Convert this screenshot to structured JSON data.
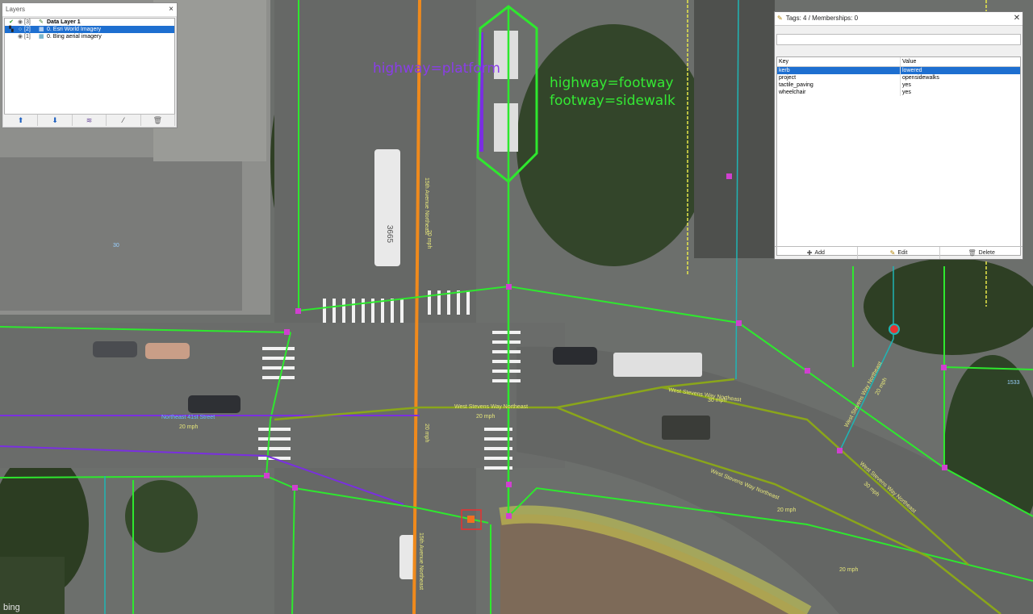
{
  "map": {
    "annotations": {
      "platform": "highway=platform",
      "footway_line1": "highway=footway",
      "footway_line2": "footway=sidewalk"
    },
    "street_labels": {
      "ave_north": "15th Avenue Northeast",
      "ave_south": "15th Avenue Northeast",
      "stevens_west": "West Stevens Way Northeast",
      "stevens_curve": "West Stevens Way Northeast",
      "stevens_curve2": "West Stevens Way Northeast",
      "stevens_north": "West Stevens Way Northeast",
      "stevens_ne_right": "West Stevens Way Northeast",
      "ne41": "Northeast 41st Street"
    },
    "speed_labels": [
      "20 mph",
      "20 mph",
      "20 mph",
      "30 mph",
      "20 mph",
      "30 mph",
      "20 mph",
      "20 mph",
      "20 mph"
    ],
    "bus_number": "3665",
    "node_label": "1533",
    "node_label2": "30"
  },
  "imagery_credit": "bing",
  "layers": {
    "title": "Layers",
    "close": "×",
    "items": [
      {
        "index": "[3]",
        "name": "Data Layer 1",
        "bold": true,
        "selected": false
      },
      {
        "index": "[2]",
        "name": "0. Esri World Imagery",
        "bold": false,
        "selected": true
      },
      {
        "index": "[1]",
        "name": "0. Bing aerial imagery",
        "bold": false,
        "selected": false
      }
    ],
    "toolbar": [
      "move-up-icon",
      "move-down-icon",
      "merge-icon",
      "delete-layer-icon",
      "trash-icon"
    ]
  },
  "tags": {
    "title": "Tags: 4 / Memberships: 0",
    "close": "✕",
    "columns": {
      "key": "Key",
      "value": "Value"
    },
    "rows": [
      {
        "key": "kerb",
        "value": "lowered",
        "selected": true
      },
      {
        "key": "project",
        "value": "opensidewalks",
        "selected": false
      },
      {
        "key": "tactile_paving",
        "value": "yes",
        "selected": false
      },
      {
        "key": "wheelchair",
        "value": "yes",
        "selected": false
      }
    ],
    "buttons": {
      "add": "Add",
      "edit": "Edit",
      "delete": "Delete"
    }
  },
  "colors": {
    "footway": "#2ee82e",
    "platform": "#7a2fe0",
    "arterial": "#f08a1c",
    "road": "#8aa61a",
    "selection": "#1e6fd0"
  }
}
